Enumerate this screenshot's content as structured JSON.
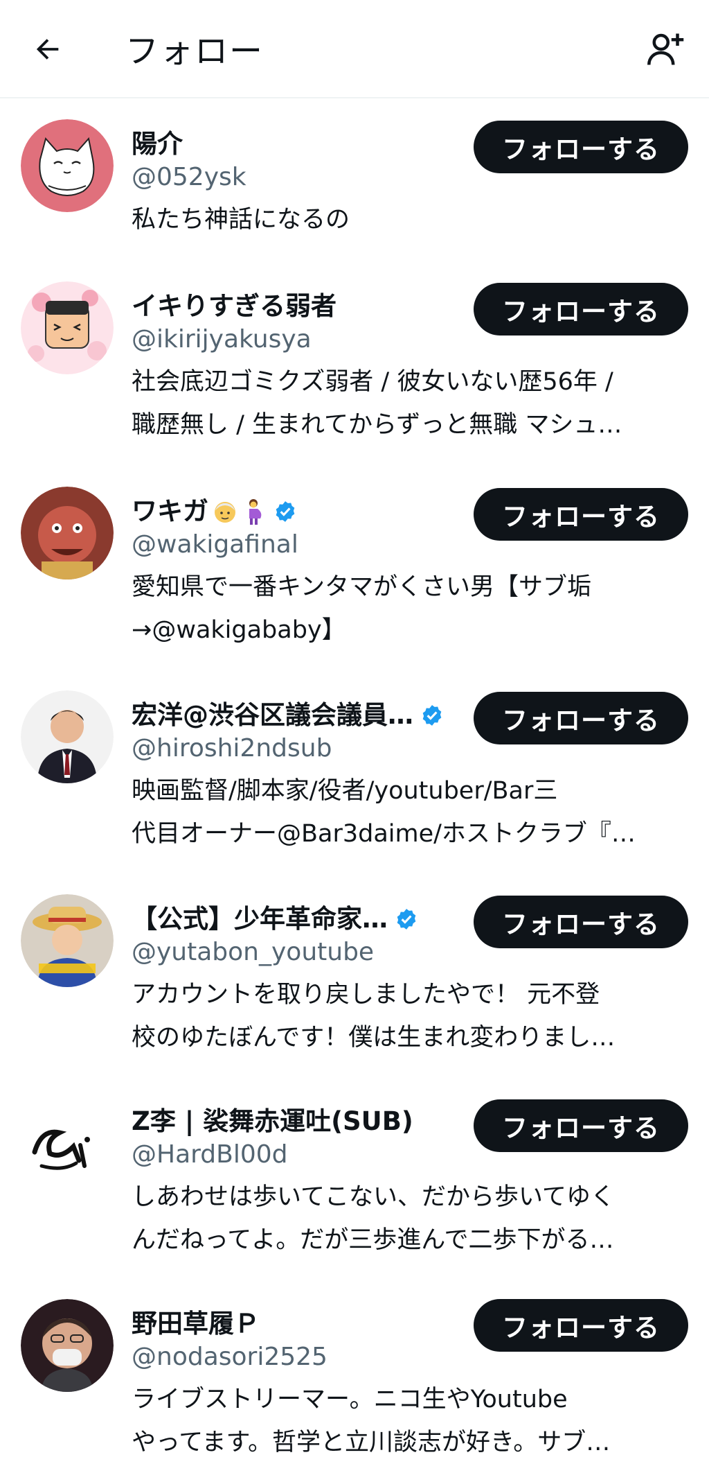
{
  "header": {
    "title": "フォロー",
    "back_icon": "arrow-left-icon",
    "add_user_icon": "person-plus-icon"
  },
  "colors": {
    "text": "#0f1419",
    "secondary": "#536471",
    "button_bg": "#0f1419",
    "button_text": "#ffffff",
    "verified": "#1d9bf0",
    "divider": "#eff3f4"
  },
  "users": [
    {
      "name": "陽介",
      "handle": "@052ysk",
      "bio": [
        "私たち神話になるの"
      ],
      "follow_label": "フォローする",
      "verified": false
    },
    {
      "name": "イキりすぎる弱者",
      "handle": "@ikirijyakusya",
      "bio": [
        "社会底辺ゴミクズ弱者 / 彼女いない歴56年 /",
        "職歴無し / 生まれてからずっと無職 マシュ…"
      ],
      "follow_label": "フォローする",
      "verified": false
    },
    {
      "name": "ワキガ",
      "handle": "@wakigafinal",
      "bio": [
        "愛知県で一番キンタマがくさい男【サブ垢",
        "→@wakigababy】"
      ],
      "follow_label": "フォローする",
      "verified": true
    },
    {
      "name": "宏洋@渋谷区議会議員…",
      "handle": "@hiroshi2ndsub",
      "bio": [
        "映画監督/脚本家/役者/youtuber/Bar三",
        "代目オーナー@Bar3daime/ホストクラブ『…"
      ],
      "follow_label": "フォローする",
      "verified": true
    },
    {
      "name": "【公式】少年革命家…",
      "handle": "@yutabon_youtube",
      "bio": [
        "アカウントを取り戻しましたやで！ 元不登",
        "校のゆたぼんです！僕は生まれ変わりまし…"
      ],
      "follow_label": "フォローする",
      "verified": true
    },
    {
      "name": "Z李 | 裟舞赤運吐(SUB)",
      "handle": "@HardBl00d",
      "bio": [
        "しあわせは歩いてこない、だから歩いてゆく",
        "んだねってよ。だが三歩進んで二歩下がる…"
      ],
      "follow_label": "フォローする",
      "verified": false
    },
    {
      "name": "野田草履Ｐ",
      "handle": "@nodasori2525",
      "bio": [
        "ライブストリーマー。ニコ生やYoutube",
        "やってます。哲学と立川談志が好き。サブ…"
      ],
      "follow_label": "フォローする",
      "verified": false
    }
  ]
}
